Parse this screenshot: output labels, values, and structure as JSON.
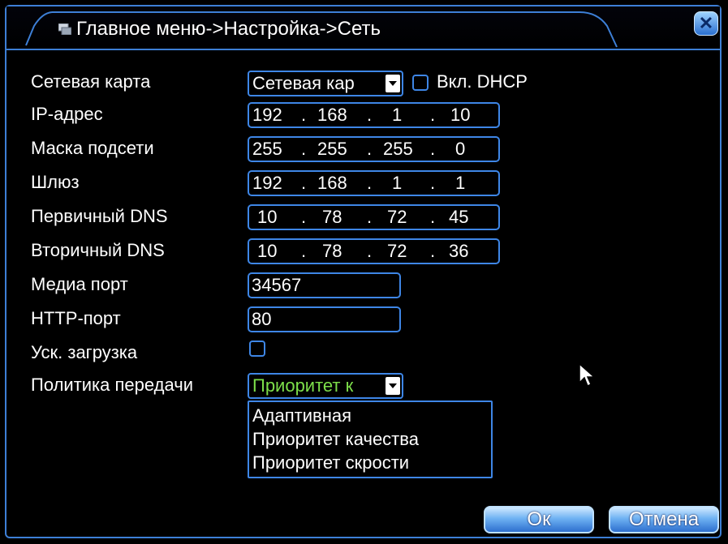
{
  "window": {
    "breadcrumb": "Главное меню->Настройка->Сеть",
    "close_glyph": "✕"
  },
  "network_card": {
    "label": "Сетевая карта",
    "value": "Сетевая кар",
    "dhcp_label": "Вкл. DHCP",
    "dhcp_checked": false
  },
  "ip_address": {
    "label": "IP-адрес",
    "octets": [
      "192",
      "168",
      "1",
      "10"
    ]
  },
  "subnet_mask": {
    "label": "Маска подсети",
    "octets": [
      "255",
      "255",
      "255",
      "0"
    ]
  },
  "gateway": {
    "label": "Шлюз",
    "octets": [
      "192",
      "168",
      "1",
      "1"
    ]
  },
  "primary_dns": {
    "label": "Первичный DNS",
    "octets": [
      "10",
      "78",
      "72",
      "45"
    ]
  },
  "secondary_dns": {
    "label": "Вторичный DNS",
    "octets": [
      "10",
      "78",
      "72",
      "36"
    ]
  },
  "media_port": {
    "label": "Медиа порт",
    "value": "34567"
  },
  "http_port": {
    "label": "HTTP-порт",
    "value": "80"
  },
  "fast_download": {
    "label": "Уск. загрузка",
    "checked": false
  },
  "transfer_policy": {
    "label": "Политика передачи",
    "value": "Приоритет к",
    "value_color": "#7ddf4a",
    "options": [
      "Адаптивная",
      "Приоритет качества",
      "Приоритет скрости"
    ]
  },
  "buttons": {
    "ok": "Ок",
    "cancel": "Отмена"
  },
  "colors": {
    "accent": "#3e86e6",
    "background": "#000000",
    "text": "#ffffff"
  }
}
